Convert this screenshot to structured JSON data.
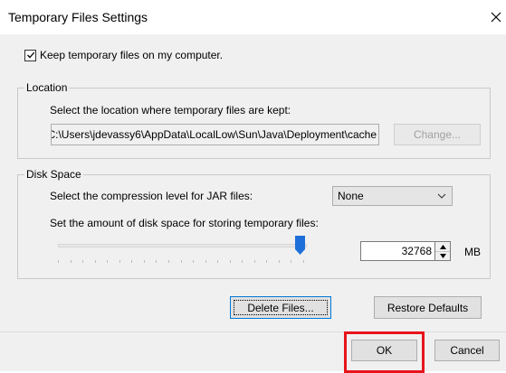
{
  "window": {
    "title": "Temporary Files Settings"
  },
  "keep_files": {
    "label": "Keep temporary files on my computer.",
    "checked": true
  },
  "location": {
    "legend": "Location",
    "instruction": "Select the location where temporary files are kept:",
    "path": "C:\\Users\\jdevassy6\\AppData\\LocalLow\\Sun\\Java\\Deployment\\cache",
    "change_label": "Change..."
  },
  "disk_space": {
    "legend": "Disk Space",
    "compression_label": "Select the compression level for JAR files:",
    "compression_value": "None",
    "amount_label": "Set the amount of disk space for storing temporary files:",
    "amount_value": "32768",
    "unit": "MB",
    "slider_fraction": 1.0
  },
  "actions": {
    "delete_label": "Delete Files...",
    "restore_label": "Restore Defaults"
  },
  "footer": {
    "ok_label": "OK",
    "cancel_label": "Cancel"
  },
  "colors": {
    "highlight": "#e8141c",
    "slider_thumb": "#1e6fd9"
  },
  "icons": {
    "close": "close-icon",
    "check": "check-icon",
    "dropdown": "chevron-down-icon"
  }
}
